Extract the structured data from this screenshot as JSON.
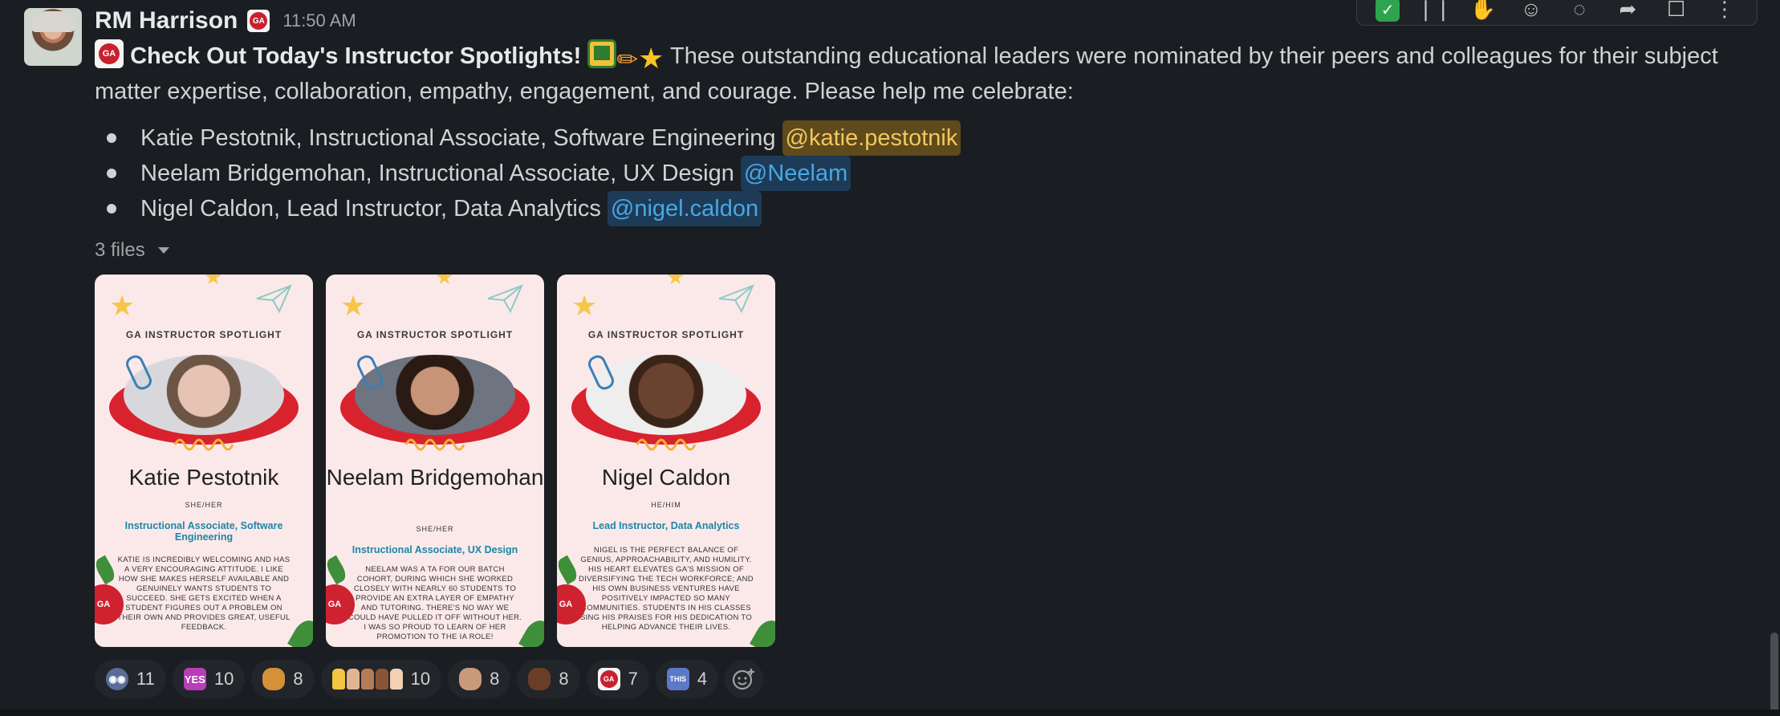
{
  "message": {
    "author": "RM Harrison",
    "time": "11:50 AM",
    "title": "Check Out Today's Instructor Spotlights!",
    "text": " These outstanding educational leaders were nominated by their peers and colleagues for their subject matter expertise, collaboration, empathy, engagement, and courage. Please help me celebrate:",
    "list": [
      {
        "text": "Katie Pestotnik, Instructional Associate, Software Engineering",
        "mention": "@katie.pestotnik"
      },
      {
        "text": "Neelam Bridgemohan, Instructional Associate, UX Design",
        "mention": "@Neelam"
      },
      {
        "text": "Nigel Caldon, Lead Instructor, Data Analytics",
        "mention": "@nigel.caldon"
      }
    ],
    "files_label": "3 files"
  },
  "cards": [
    {
      "header": "GA INSTRUCTOR SPOTLIGHT",
      "name": "Katie Pestotnik",
      "pronouns": "SHE/HER",
      "role": "Instructional Associate, Software Engineering",
      "desc": "KATIE IS INCREDIBLY WELCOMING AND HAS A VERY ENCOURAGING ATTITUDE. I LIKE HOW SHE MAKES HERSELF AVAILABLE AND GENUINELY WANTS STUDENTS TO SUCCEED. SHE GETS EXCITED WHEN A STUDENT FIGURES OUT A PROBLEM ON THEIR OWN AND PROVIDES GREAT, USEFUL FEEDBACK.",
      "photo_color": "#c9a99a"
    },
    {
      "header": "GA INSTRUCTOR SPOTLIGHT",
      "name": "Neelam Bridgemohan",
      "pronouns": "SHE/HER",
      "role": "Instructional Associate, UX Design",
      "desc": "NEELAM WAS A TA FOR OUR BATCH COHORT, DURING WHICH SHE WORKED CLOSELY WITH NEARLY 60 STUDENTS TO PROVIDE AN EXTRA LAYER OF EMPATHY AND TUTORING. THERE'S NO WAY WE COULD HAVE PULLED IT OFF WITHOUT HER. I WAS SO PROUD TO LEARN OF HER PROMOTION TO THE IA ROLE!",
      "photo_color": "#8a6a58"
    },
    {
      "header": "GA INSTRUCTOR SPOTLIGHT",
      "name": "Nigel Caldon",
      "pronouns": "HE/HIM",
      "role": "Lead Instructor, Data Analytics",
      "desc": "NIGEL IS THE PERFECT BALANCE OF GENIUS, APPROACHABILITY, AND HUMILITY. HIS HEART ELEVATES GA'S MISSION OF DIVERSIFYING THE TECH WORKFORCE; AND HIS OWN BUSINESS VENTURES HAVE POSITIVELY IMPACTED SO MANY COMMUNITIES. STUDENTS IN HIS CLASSES SING HIS PRAISES FOR HIS DEDICATION TO HELPING ADVANCE THEIR LIVES.",
      "photo_color": "#5a3a2a"
    }
  ],
  "reactions": [
    {
      "icon": "eyes-emoji",
      "count": "11"
    },
    {
      "icon": "yes-emoji",
      "label": "YES",
      "count": "10"
    },
    {
      "icon": "dinosaur-emoji",
      "count": "8"
    },
    {
      "icon": "raised-hands-multi-emoji",
      "count": "10"
    },
    {
      "icon": "clap-emoji",
      "count": "8"
    },
    {
      "icon": "raised-hands-dark-emoji",
      "count": "8"
    },
    {
      "icon": "ga-apple-emoji",
      "label": "GA",
      "count": "7"
    },
    {
      "icon": "this-emoji",
      "label": "THIS",
      "count": "4"
    }
  ],
  "colors": {
    "background": "#1a1d21",
    "mention_bg": "#1d3b57",
    "mention_fg": "#4aa6e3",
    "self_mention_bg": "#5e4a1c",
    "self_mention_fg": "#f2c75c",
    "ga_red": "#c8202f"
  }
}
